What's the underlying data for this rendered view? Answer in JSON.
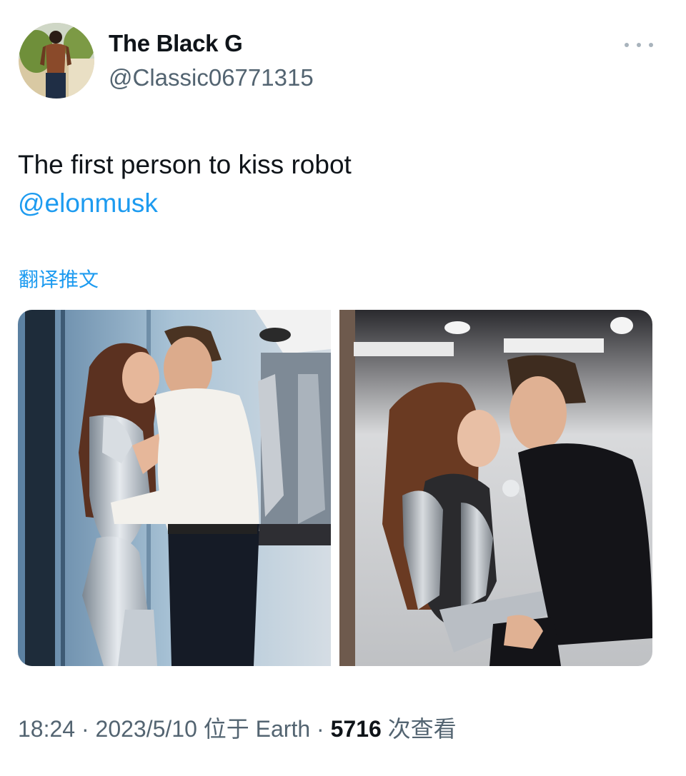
{
  "author": {
    "display_name": "The Black G",
    "handle": "@Classic06771315"
  },
  "tweet": {
    "text": "The first person to kiss robot",
    "mention": "@elonmusk",
    "translate_label": "翻译推文"
  },
  "meta": {
    "time": "18:24",
    "separator_1": " · ",
    "date": "2023/5/10",
    "location": " 位于 Earth",
    "separator_2": " · ",
    "views_count": "5716",
    "views_label": " 次查看"
  },
  "icons": {
    "more": "more-horizontal-icon"
  },
  "colors": {
    "link": "#1d9bf0",
    "secondary_text": "#536471",
    "primary_text": "#0f1419"
  }
}
